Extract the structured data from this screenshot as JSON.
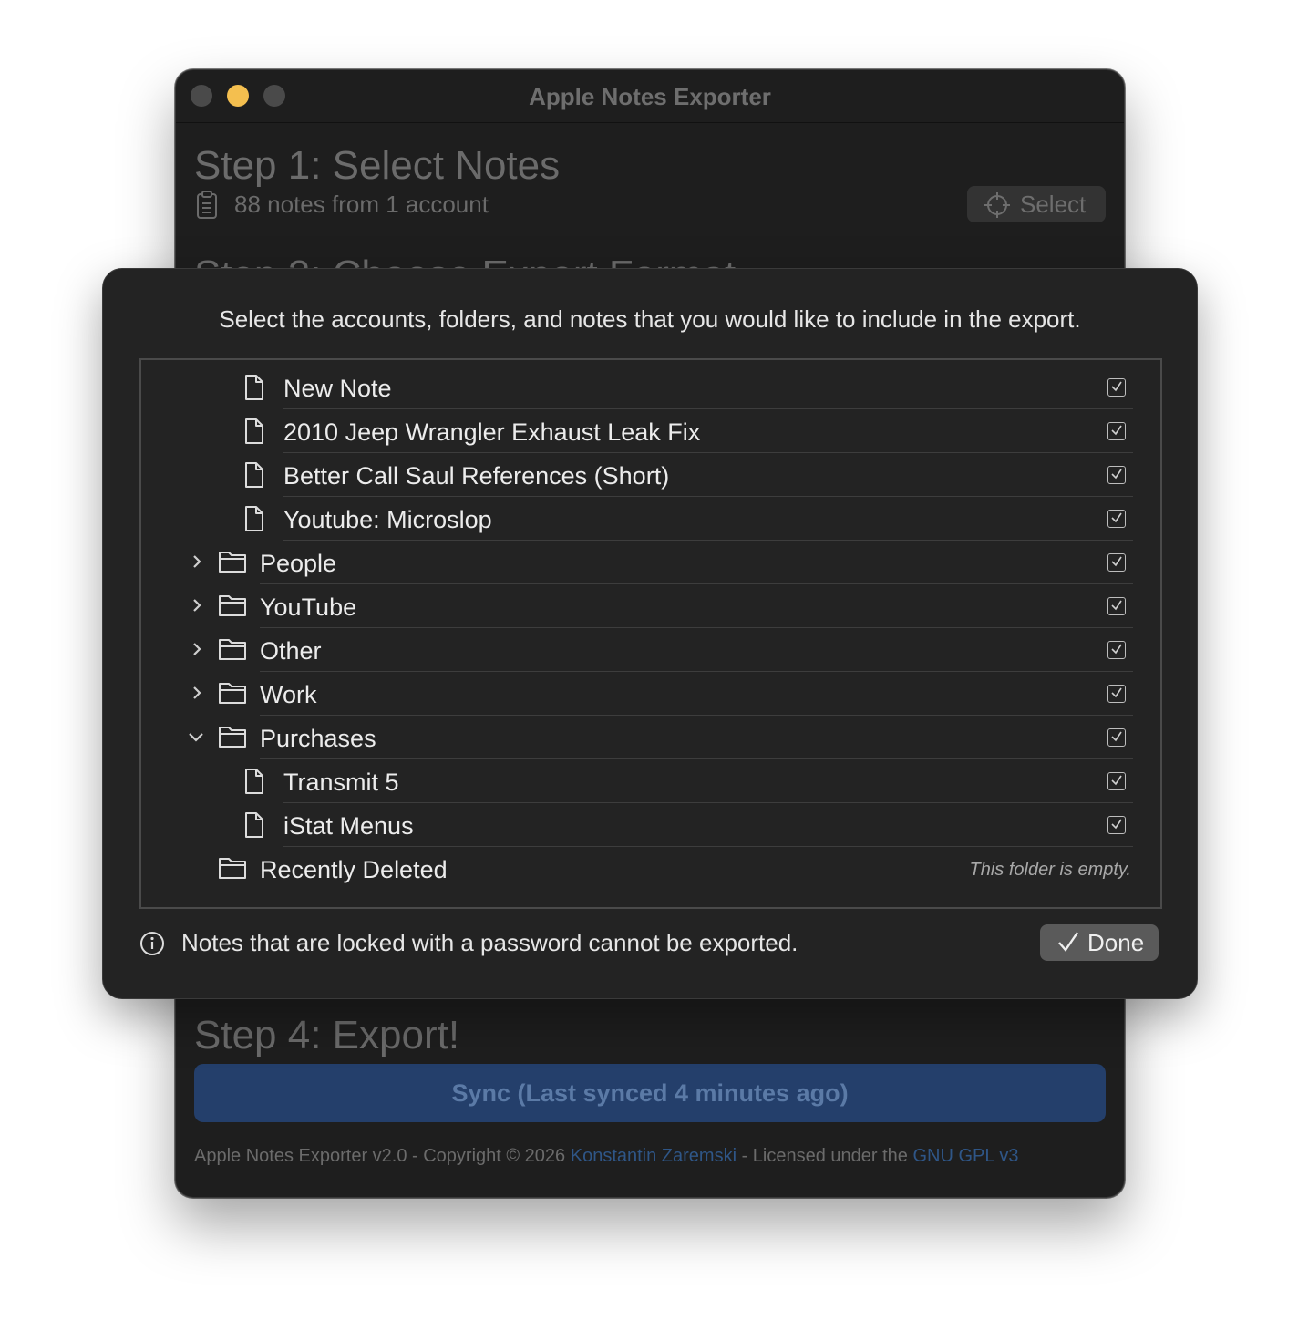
{
  "window": {
    "title": "Apple Notes Exporter"
  },
  "step1": {
    "title": "Step 1: Select Notes",
    "summary": "88 notes from 1 account",
    "select_label": "Select"
  },
  "step2": {
    "title": "Step 2: Choose Export Format"
  },
  "step4": {
    "title": "Step 4: Export!",
    "sync_label": "Sync (Last synced 4 minutes ago)"
  },
  "footer": {
    "prefix": "Apple Notes Exporter v2.0 - Copyright © 2026 ",
    "author": "Konstantin Zaremski",
    "middle": " - Licensed under the ",
    "license": "GNU GPL v3"
  },
  "sheet": {
    "prompt": "Select the accounts, folders, and notes that you would like to include in the export.",
    "tree": [
      {
        "type": "note",
        "label": "New Note",
        "checked": true
      },
      {
        "type": "note",
        "label": "2010 Jeep Wrangler Exhaust Leak Fix",
        "checked": true
      },
      {
        "type": "note",
        "label": "Better Call Saul References (Short)",
        "checked": true
      },
      {
        "type": "note",
        "label": "Youtube: Microslop",
        "checked": true
      },
      {
        "type": "folder",
        "label": "People",
        "expanded": false,
        "checked": true
      },
      {
        "type": "folder",
        "label": "YouTube",
        "expanded": false,
        "checked": true
      },
      {
        "type": "folder",
        "label": "Other",
        "expanded": false,
        "checked": true
      },
      {
        "type": "folder",
        "label": "Work",
        "expanded": false,
        "checked": true
      },
      {
        "type": "folder",
        "label": "Purchases",
        "expanded": true,
        "checked": true
      },
      {
        "type": "note",
        "label": "Transmit 5",
        "checked": true
      },
      {
        "type": "note",
        "label": "iStat Menus",
        "checked": true
      },
      {
        "type": "folder-empty",
        "label": "Recently Deleted",
        "empty_text": "This folder is empty."
      }
    ],
    "info_text": "Notes that are locked with a password cannot be exported.",
    "done_label": "Done"
  },
  "icons": [
    "clipboard-icon",
    "crosshair-icon",
    "note-icon",
    "folder-icon",
    "chevron-right-icon",
    "chevron-down-icon",
    "checkbox-check-icon",
    "info-icon",
    "checkmark-icon"
  ],
  "colors": {
    "window_bg": "#1e1e1e",
    "sheet_bg": "#232323",
    "sync_button": "#243f6b",
    "link": "#2f5687",
    "minimize_light": "#f4bf4f"
  }
}
